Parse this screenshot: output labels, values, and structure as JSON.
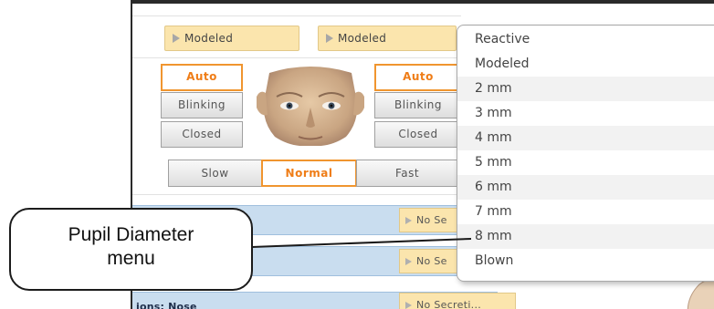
{
  "top_pills": {
    "left_label": "Modeled",
    "right_label": "Modeled"
  },
  "eye_controls": {
    "left": {
      "auto_label": "Auto",
      "blinking_label": "Blinking",
      "closed_label": "Closed"
    },
    "right": {
      "auto_label": "Auto",
      "blinking_label": "Blinking",
      "closed_label": "Closed"
    },
    "selected_mode": "Auto"
  },
  "speed_controls": {
    "slow_label": "Slow",
    "normal_label": "Normal",
    "fast_label": "Fast",
    "selected": "Normal"
  },
  "secretion_rows": [
    {
      "label": "",
      "value": "No Se"
    },
    {
      "label": "",
      "value": "No Se"
    },
    {
      "label": "ions: Nose",
      "value": "No Secreti..."
    }
  ],
  "pupil_dropdown": {
    "items": [
      "Reactive",
      "Modeled",
      "2 mm",
      "3 mm",
      "4 mm",
      "5 mm",
      "6 mm",
      "7 mm",
      "8 mm",
      "Blown"
    ]
  },
  "callout": {
    "line1": "Pupil Diameter",
    "line2": "menu"
  },
  "colors": {
    "pill_fill": "#fbe5ad",
    "active_border": "#f0952f",
    "active_text": "#ef7d17",
    "row_band": "#c9ddef",
    "row_label": "#1e2d4a"
  },
  "icons": {
    "dropdown_arrow": "play-triangle-icon",
    "face": "mannequin-face-icon"
  }
}
